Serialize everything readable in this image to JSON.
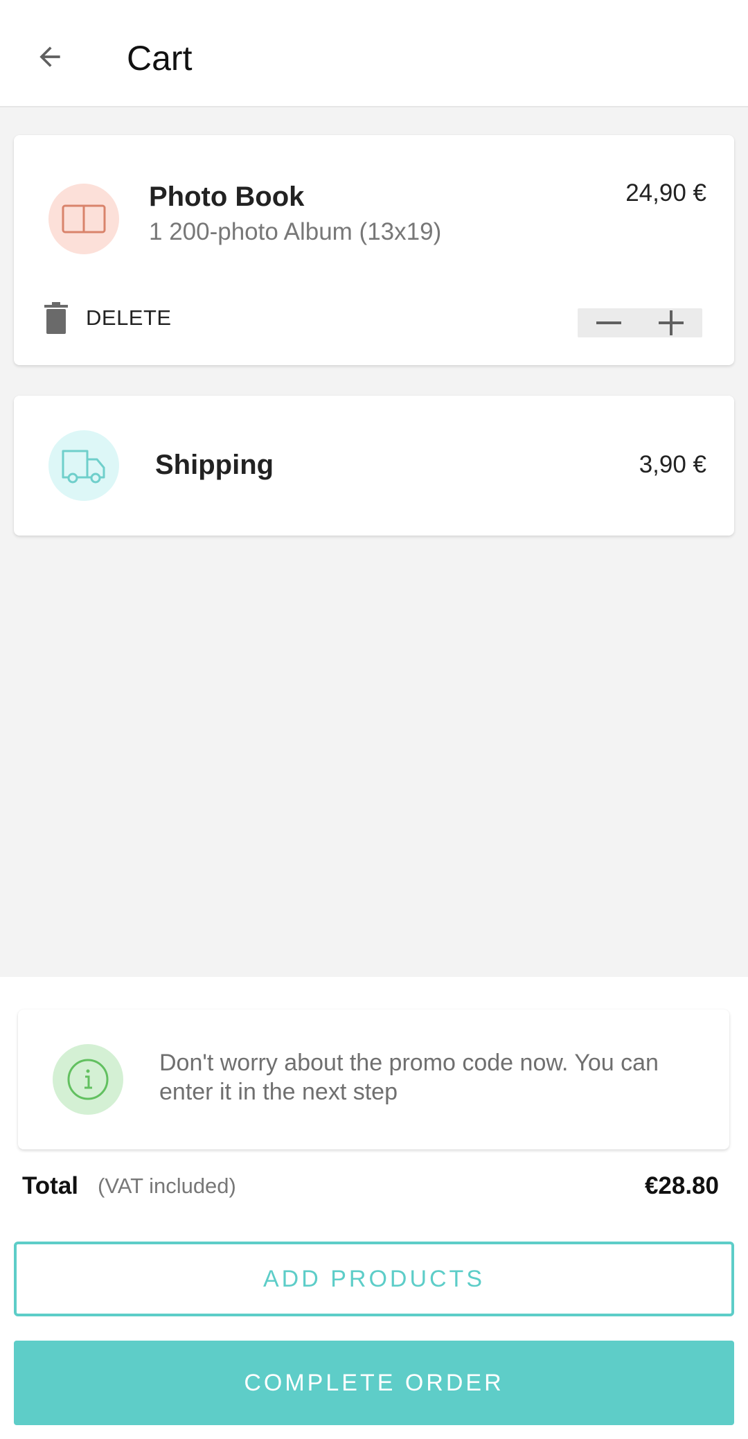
{
  "header": {
    "title": "Cart",
    "back_icon": "arrow-left-icon"
  },
  "cart": {
    "items": [
      {
        "name": "Photo Book",
        "description": "1 200-photo Album (13x19)",
        "price": "24,90 €",
        "icon": "photo-book-icon",
        "icon_bg": "#fce0d9",
        "icon_color": "#d9836b",
        "delete_label": "DELETE"
      }
    ],
    "shipping": {
      "label": "Shipping",
      "price": "3,90 €",
      "icon": "truck-icon",
      "icon_bg": "#ddf7f7",
      "icon_color": "#6fcfcb"
    }
  },
  "promo": {
    "text": "Don't worry about the promo code now. You can enter it in the next step",
    "icon": "info-icon"
  },
  "summary": {
    "total_label": "Total",
    "vat_label": "(VAT included)",
    "total_value": "€28.80"
  },
  "actions": {
    "add_products": "ADD PRODUCTS",
    "complete_order": "COMPLETE ORDER"
  },
  "colors": {
    "accent": "#5ecdc8",
    "background": "#f3f3f3"
  }
}
